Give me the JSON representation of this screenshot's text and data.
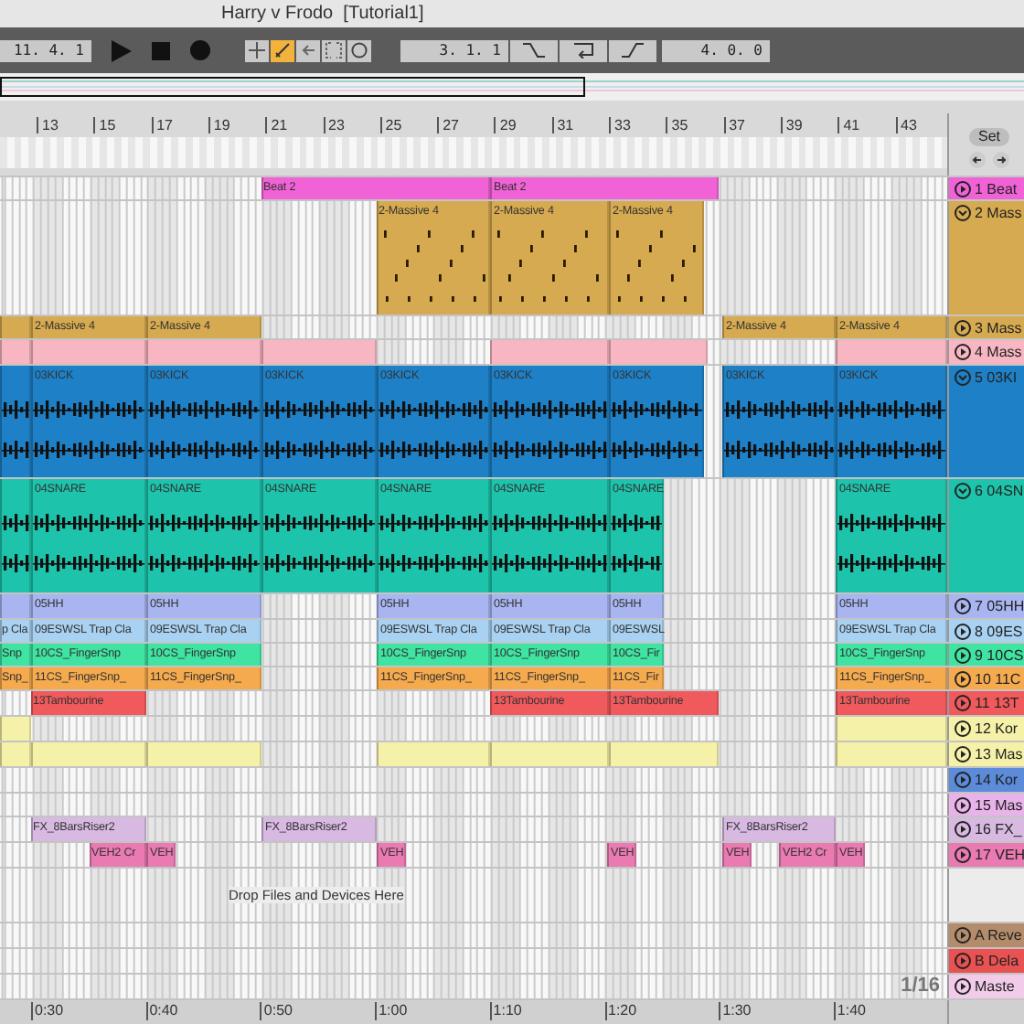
{
  "window": {
    "title": "Harry v Frodo  [Tutorial1]"
  },
  "transport": {
    "position": "11. 4. 1",
    "tools": [
      {
        "kind": "plus",
        "selected": false
      },
      {
        "kind": "draw",
        "selected": true
      },
      {
        "kind": "back",
        "selected": false
      },
      {
        "kind": "crop",
        "selected": false
      },
      {
        "kind": "circle",
        "selected": false
      }
    ],
    "loop_start": "3. 1. 1",
    "loop_length": "4. 0. 0"
  },
  "ruler": {
    "bars": [
      "13",
      "15",
      "17",
      "19",
      "21",
      "23",
      "25",
      "27",
      "29",
      "31",
      "33",
      "35",
      "37",
      "39",
      "41",
      "43"
    ],
    "set_label": "Set"
  },
  "tracks": [
    {
      "name": "1 Beat",
      "color": "#f062d6",
      "kind": "plain",
      "expanded": false,
      "clips": [
        {
          "label": "Beat 2"
        },
        {
          "label": "Beat 2"
        }
      ]
    },
    {
      "name": "2 Mass",
      "color": "#d6aa50",
      "kind": "midi",
      "expanded": true,
      "clips": [
        {
          "label": "2-Massive 4"
        },
        {
          "label": "2-Massive 4"
        },
        {
          "label": "2-Massive 4"
        }
      ]
    },
    {
      "name": "3 Mass",
      "color": "#d6aa50",
      "kind": "plain",
      "expanded": false,
      "clips": [
        {
          "kind": "clip"
        },
        {
          "label": "2-Massive 4"
        },
        {
          "label": "2-Massive 4"
        },
        {
          "label": "2-Massive 4"
        },
        {
          "label": "2-Massive 4"
        }
      ]
    },
    {
      "name": "4 Mass",
      "color": "#f7b6c2",
      "kind": "plain",
      "expanded": false,
      "clips": [
        {
          "kind": "clip"
        },
        {
          "kind": "clip"
        },
        {
          "kind": "clip"
        },
        {
          "kind": "clip"
        },
        {
          "kind": "clip"
        },
        {
          "kind": "clip"
        },
        {
          "kind": "clip"
        }
      ]
    },
    {
      "name": "5 03KI",
      "color": "#1e80c6",
      "kind": "audio",
      "expanded": true,
      "clips": [
        {
          "kind": "clip"
        },
        {
          "label": "03KICK"
        },
        {
          "label": "03KICK"
        },
        {
          "label": "03KICK"
        },
        {
          "label": "03KICK"
        },
        {
          "label": "03KICK"
        },
        {
          "label": "03KICK"
        },
        {
          "label": "03KICK"
        },
        {
          "label": "03KICK"
        }
      ]
    },
    {
      "name": "6 04SN",
      "color": "#1dc3ab",
      "kind": "audio",
      "expanded": true,
      "clips": [
        {
          "kind": "clip"
        },
        {
          "label": "04SNARE"
        },
        {
          "label": "04SNARE"
        },
        {
          "label": "04SNARE"
        },
        {
          "label": "04SNARE"
        },
        {
          "label": "04SNARE"
        },
        {
          "label": "04SNARE"
        },
        {
          "label": "04SNARE"
        }
      ]
    },
    {
      "name": "7 05HH",
      "color": "#a9b5f0",
      "kind": "plain",
      "expanded": false,
      "clips": [
        {
          "kind": "clip"
        },
        {
          "label": "05HH"
        },
        {
          "label": "05HH"
        },
        {
          "label": "05HH"
        },
        {
          "label": "05HH"
        },
        {
          "label": "05HH"
        },
        {
          "label": "05HH"
        }
      ]
    },
    {
      "name": "8 09ES",
      "color": "#a9d2f2",
      "kind": "plain",
      "expanded": false,
      "clips": [
        {
          "label": "p Cla"
        },
        {
          "label": "09ESWSL Trap Cla"
        },
        {
          "label": "09ESWSL Trap Cla"
        },
        {
          "label": "09ESWSL Trap Cla"
        },
        {
          "label": "09ESWSL Trap Cla"
        },
        {
          "label": "09ESWSL"
        },
        {
          "label": "09ESWSL Trap Cla"
        }
      ]
    },
    {
      "name": "9 10CS",
      "color": "#3fe3a2",
      "kind": "plain",
      "expanded": false,
      "clips": [
        {
          "label": "Snp"
        },
        {
          "label": "10CS_FingerSnp"
        },
        {
          "label": "10CS_FingerSnp"
        },
        {
          "label": "10CS_FingerSnp"
        },
        {
          "label": "10CS_FingerSnp"
        },
        {
          "label": "10CS_Fir"
        },
        {
          "label": "10CS_FingerSnp"
        }
      ]
    },
    {
      "name": "10 11C",
      "color": "#f6aa4e",
      "kind": "plain",
      "expanded": false,
      "clips": [
        {
          "label": "Snp_"
        },
        {
          "label": "11CS_FingerSnp_"
        },
        {
          "label": "11CS_FingerSnp_"
        },
        {
          "label": "11CS_FingerSnp_"
        },
        {
          "label": "11CS_FingerSnp_"
        },
        {
          "label": "11CS_Fir"
        },
        {
          "label": "11CS_FingerSnp_"
        }
      ]
    },
    {
      "name": "11 13T",
      "color": "#f05a5c",
      "kind": "plain",
      "expanded": false,
      "clips": [
        {
          "label": "13Tambourine"
        },
        {
          "label": "13Tambourine"
        },
        {
          "label": "13Tambourine"
        },
        {
          "label": "13Tambourine"
        }
      ]
    },
    {
      "name": "12 Kor",
      "color": "#f6f1a8",
      "kind": "plain",
      "expanded": false,
      "clips": [
        {
          "kind": "clip"
        },
        {
          "kind": "clip"
        }
      ]
    },
    {
      "name": "13 Mas",
      "color": "#f6f1a8",
      "kind": "plain",
      "expanded": false,
      "clips": [
        {
          "kind": "clip"
        },
        {
          "kind": "clip"
        },
        {
          "kind": "clip"
        },
        {
          "kind": "clip"
        },
        {
          "kind": "clip"
        },
        {
          "kind": "clip"
        },
        {
          "kind": "clip"
        }
      ]
    },
    {
      "name": "14 Kor",
      "color": "#5b8bd9",
      "expanded": false
    },
    {
      "name": "15 Mas",
      "color": "#e9b2ea",
      "expanded": false
    },
    {
      "name": "16 FX_",
      "color": "#d7b9e1",
      "kind": "plain",
      "expanded": false,
      "clips": [
        {
          "label": "FX_8BarsRiser2"
        },
        {
          "label": "FX_8BarsRiser2"
        },
        {
          "label": "FX_8BarsRiser2"
        }
      ]
    },
    {
      "name": "17 VEH",
      "color": "#e97ab2",
      "kind": "plain",
      "expanded": false,
      "clips": [
        {
          "label": "VEH2 Cr"
        },
        {
          "label": "VEH"
        },
        {
          "label": "VEH"
        },
        {
          "label": "VEH"
        },
        {
          "label": "VEH"
        },
        {
          "label": "VEH2 Cr"
        },
        {
          "label": "VEH"
        }
      ]
    }
  ],
  "drop_hint": "Drop Files and Devices Here",
  "returns": [
    {
      "name": "A Reve",
      "color": "#b38c6c"
    },
    {
      "name": "B Dela",
      "color": "#e95252"
    },
    {
      "name": "Maste",
      "color": "#f2cbea"
    }
  ],
  "grid_setting": "1/16",
  "time_ruler": [
    "0:30",
    "0:40",
    "0:50",
    "1:00",
    "1:10",
    "1:20",
    "1:30",
    "1:40"
  ]
}
